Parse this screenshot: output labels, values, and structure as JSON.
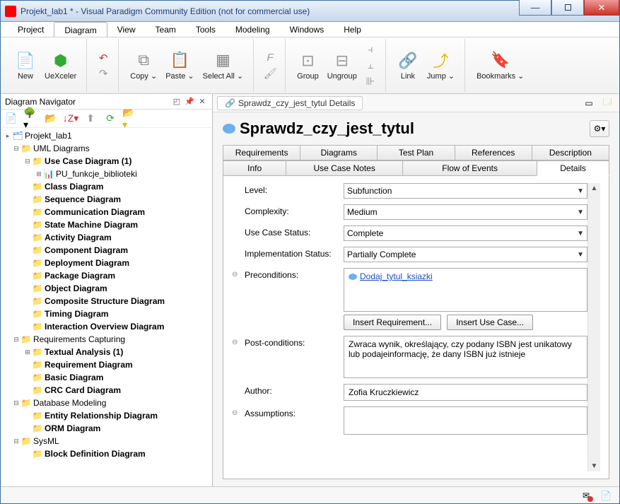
{
  "window": {
    "title": "Projekt_lab1 * - Visual Paradigm Community Edition (not for commercial use)"
  },
  "menu": {
    "items": [
      "Project",
      "Diagram",
      "View",
      "Team",
      "Tools",
      "Modeling",
      "Windows",
      "Help"
    ],
    "active": 1
  },
  "toolbar": {
    "new": "New",
    "uexceler": "UeXceler",
    "copy": "Copy ⌄",
    "paste": "Paste ⌄",
    "selectall": "Select All ⌄",
    "group": "Group",
    "ungroup": "Ungroup",
    "link": "Link",
    "jump": "Jump ⌄",
    "bookmarks": "Bookmarks ⌄"
  },
  "navigator": {
    "title": "Diagram Navigator",
    "tree": [
      {
        "d": 0,
        "t": "Projekt_lab1",
        "icon": "proj",
        "toggle": "▸"
      },
      {
        "d": 1,
        "t": "UML Diagrams",
        "icon": "folder",
        "toggle": "−",
        "bold": false
      },
      {
        "d": 2,
        "t": "Use Case Diagram (1)",
        "icon": "folder",
        "toggle": "−",
        "bold": true
      },
      {
        "d": 3,
        "t": "PU_funkcje_biblioteki",
        "icon": "diag",
        "toggle": "+",
        "bold": false
      },
      {
        "d": 2,
        "t": "Class Diagram",
        "icon": "folder",
        "toggle": "",
        "bold": true
      },
      {
        "d": 2,
        "t": "Sequence Diagram",
        "icon": "folder",
        "toggle": "",
        "bold": true
      },
      {
        "d": 2,
        "t": "Communication Diagram",
        "icon": "folder",
        "toggle": "",
        "bold": true
      },
      {
        "d": 2,
        "t": "State Machine Diagram",
        "icon": "folder",
        "toggle": "",
        "bold": true
      },
      {
        "d": 2,
        "t": "Activity Diagram",
        "icon": "folder",
        "toggle": "",
        "bold": true
      },
      {
        "d": 2,
        "t": "Component Diagram",
        "icon": "folder",
        "toggle": "",
        "bold": true
      },
      {
        "d": 2,
        "t": "Deployment Diagram",
        "icon": "folder",
        "toggle": "",
        "bold": true
      },
      {
        "d": 2,
        "t": "Package Diagram",
        "icon": "folder",
        "toggle": "",
        "bold": true
      },
      {
        "d": 2,
        "t": "Object Diagram",
        "icon": "folder",
        "toggle": "",
        "bold": true
      },
      {
        "d": 2,
        "t": "Composite Structure Diagram",
        "icon": "folder",
        "toggle": "",
        "bold": true
      },
      {
        "d": 2,
        "t": "Timing Diagram",
        "icon": "folder",
        "toggle": "",
        "bold": true
      },
      {
        "d": 2,
        "t": "Interaction Overview Diagram",
        "icon": "folder",
        "toggle": "",
        "bold": true
      },
      {
        "d": 1,
        "t": "Requirements Capturing",
        "icon": "folder",
        "toggle": "−",
        "bold": false
      },
      {
        "d": 2,
        "t": "Textual Analysis (1)",
        "icon": "folder",
        "toggle": "+",
        "bold": true
      },
      {
        "d": 2,
        "t": "Requirement Diagram",
        "icon": "folder",
        "toggle": "",
        "bold": true
      },
      {
        "d": 2,
        "t": "Basic Diagram",
        "icon": "folder",
        "toggle": "",
        "bold": true
      },
      {
        "d": 2,
        "t": "CRC Card Diagram",
        "icon": "folder",
        "toggle": "",
        "bold": true
      },
      {
        "d": 1,
        "t": "Database Modeling",
        "icon": "folder",
        "toggle": "−",
        "bold": false
      },
      {
        "d": 2,
        "t": "Entity Relationship Diagram",
        "icon": "folder",
        "toggle": "",
        "bold": true
      },
      {
        "d": 2,
        "t": "ORM Diagram",
        "icon": "folder",
        "toggle": "",
        "bold": true
      },
      {
        "d": 1,
        "t": "SysML",
        "icon": "folder",
        "toggle": "−",
        "bold": false
      },
      {
        "d": 2,
        "t": "Block Definition Diagram",
        "icon": "folder",
        "toggle": "",
        "bold": true
      }
    ]
  },
  "breadcrumb": {
    "item": "Sprawdz_czy_jest_tytul Details"
  },
  "page": {
    "heading": "Sprawdz_czy_jest_tytul"
  },
  "tabs": {
    "row1": [
      "Requirements",
      "Diagrams",
      "Test Plan",
      "References",
      "Description"
    ],
    "row2": [
      "Info",
      "Use Case Notes",
      "Flow of Events",
      "Details"
    ],
    "active": "Details"
  },
  "form": {
    "level_label": "Level:",
    "level_value": "Subfunction",
    "complexity_label": "Complexity:",
    "complexity_value": "Medium",
    "status_label": "Use Case Status:",
    "status_value": "Complete",
    "impl_label": "Implementation Status:",
    "impl_value": "Partially Complete",
    "precond_label": "Preconditions:",
    "precond_link": "Dodaj_tytul_ksiazki",
    "insert_req": "Insert Requirement...",
    "insert_uc": "Insert Use Case...",
    "postcond_label": "Post-conditions:",
    "postcond_value": "Zwraca wynik, określający, czy podany ISBN jest unikatowy lub podajeinformację, że dany ISBN już istnieje",
    "author_label": "Author:",
    "author_value": "Zofia Kruczkiewicz",
    "assumptions_label": "Assumptions:",
    "assumptions_value": ""
  }
}
